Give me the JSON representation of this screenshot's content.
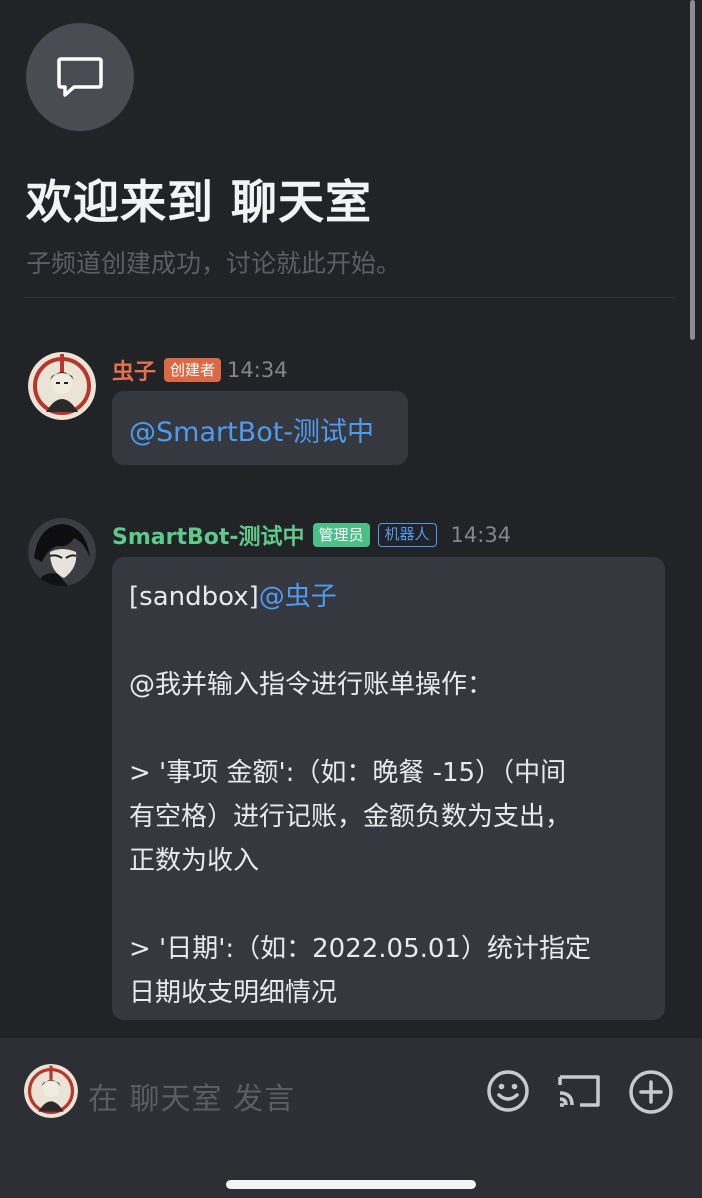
{
  "header": {
    "title": "欢迎来到 聊天室",
    "subtitle": "子频道创建成功，讨论就此开始。",
    "channel_icon": "chat-bubble-icon"
  },
  "messages": [
    {
      "author": "虫子",
      "author_color": "#e8704d",
      "badges": [
        {
          "label": "创建者",
          "bg": "#d96a45",
          "fg": "#ffffff"
        }
      ],
      "time": "14:34",
      "text": "@SmartBot-测试中"
    },
    {
      "author": "SmartBot-测试中",
      "author_color": "#5ec98a",
      "badges": [
        {
          "label": "管理员",
          "bg": "#4cbf86",
          "fg": "#ffffff"
        },
        {
          "label": "机器人",
          "bg": "transparent",
          "fg": "#4f9bf0",
          "border": "#4f9bf0"
        }
      ],
      "time": "14:34",
      "prefix": "[sandbox]",
      "mention": "@虫子",
      "lines": [
        "@我并输入指令进行账单操作：",
        "> '事项 金额':（如：晚餐 -15）（中间",
        "有空格）进行记账，金额负数为支出，",
        "正数为收入",
        "> '日期':（如：2022.05.01）统计指定",
        "日期收支明细情况"
      ]
    }
  ],
  "composer": {
    "placeholder": "在 聊天室 发言",
    "icons": [
      "emoji-icon",
      "screen-share-icon",
      "add-icon"
    ]
  },
  "colors": {
    "background": "#222326",
    "bubble": "#363840",
    "mention": "#4f9bf0",
    "composer": "#2e2f34"
  }
}
